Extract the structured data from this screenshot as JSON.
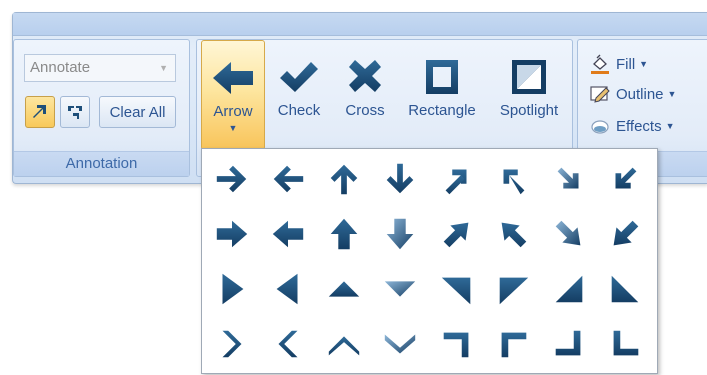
{
  "annotation": {
    "combo_value": "Annotate",
    "clear_all_label": "Clear All",
    "group_label": "Annotation",
    "arrow_button_icon": "arrow-up-right-icon",
    "arrows_toggle_icon": "multi-arrow-icon"
  },
  "shapes": {
    "buttons": [
      {
        "label": "Arrow",
        "icon": "arrow-left-icon",
        "active": true
      },
      {
        "label": "Check",
        "icon": "check-icon"
      },
      {
        "label": "Cross",
        "icon": "cross-icon"
      },
      {
        "label": "Rectangle",
        "icon": "rectangle-icon"
      },
      {
        "label": "Spotlight",
        "icon": "spotlight-icon"
      }
    ]
  },
  "format": {
    "fill_label": "Fill",
    "outline_label": "Outline",
    "effects_label": "Effects"
  },
  "gallery": {
    "rows": [
      [
        "arrow-right-thin",
        "arrow-left-thin",
        "arrow-up-thin",
        "arrow-down-thin",
        "arrow-up-right-thin",
        "arrow-up-left-thin",
        "arrow-down-right-thin",
        "arrow-down-left-thin"
      ],
      [
        "arrow-right-bold",
        "arrow-left-bold",
        "arrow-up-bold",
        "arrow-down-bold",
        "arrow-up-right-bold",
        "arrow-up-left-bold",
        "arrow-down-right-bold",
        "arrow-down-left-bold"
      ],
      [
        "triangle-right",
        "triangle-left",
        "triangle-up",
        "triangle-down",
        "triangle-top-right",
        "triangle-top-left",
        "triangle-bottom-right",
        "triangle-bottom-left"
      ],
      [
        "chevron-right",
        "chevron-left",
        "chevron-up",
        "chevron-down",
        "corner-top-right",
        "corner-top-left",
        "corner-bottom-right",
        "corner-bottom-left"
      ]
    ]
  },
  "colors": {
    "icon_dark": "#1e4f7a",
    "icon_light": "#6f9ec4",
    "accent_orange": "#e07b1a"
  }
}
